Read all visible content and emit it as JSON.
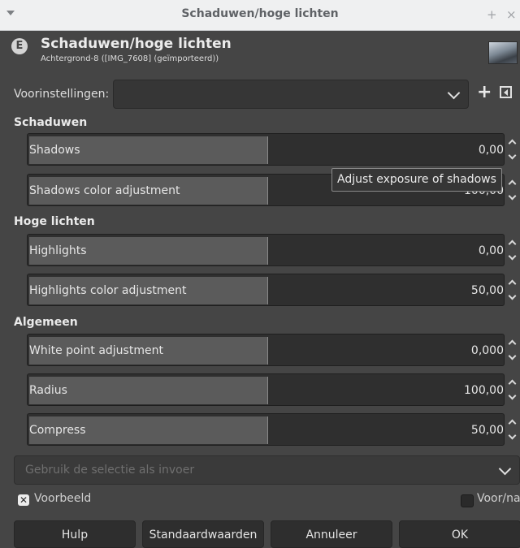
{
  "window": {
    "title": "Schaduwen/hoge lichten",
    "add_symbol": "+",
    "close_symbol": "×"
  },
  "header": {
    "icon_letter": "E",
    "title": "Schaduwen/hoge lichten",
    "subtitle": "Achtergrond-8 ([IMG_7608] (geïmporteerd))"
  },
  "presets": {
    "label": "Voorinstellingen:",
    "value": "",
    "add_symbol": "+"
  },
  "sections": {
    "shadows": "Schaduwen",
    "highlights": "Hoge lichten",
    "general": "Algemeen"
  },
  "sliders": {
    "shadows": {
      "label": "Shadows",
      "value": "0,00",
      "fill": 0.5
    },
    "shadows_color": {
      "label": "Shadows color adjustment",
      "value": "100,00",
      "fill": 0.5
    },
    "highlights": {
      "label": "Highlights",
      "value": "0,00",
      "fill": 0.5
    },
    "highlights_color": {
      "label": "Highlights color adjustment",
      "value": "50,00",
      "fill": 0.5
    },
    "white_point": {
      "label": "White point adjustment",
      "value": "0,000",
      "fill": 0.5
    },
    "radius": {
      "label": "Radius",
      "value": "100,00",
      "fill": 0.5
    },
    "compress": {
      "label": "Compress",
      "value": "50,00",
      "fill": 0.5
    }
  },
  "tooltip": "Adjust exposure of shadows",
  "selection_input": {
    "text": "Gebruik de selectie als invoer"
  },
  "preview": {
    "label": "Voorbeeld",
    "checked": true
  },
  "split": {
    "label": "Voor/na",
    "checked": false
  },
  "buttons": {
    "help": "Hulp",
    "defaults": "Standaardwaarden",
    "cancel": "Annuleer",
    "ok": "OK"
  }
}
